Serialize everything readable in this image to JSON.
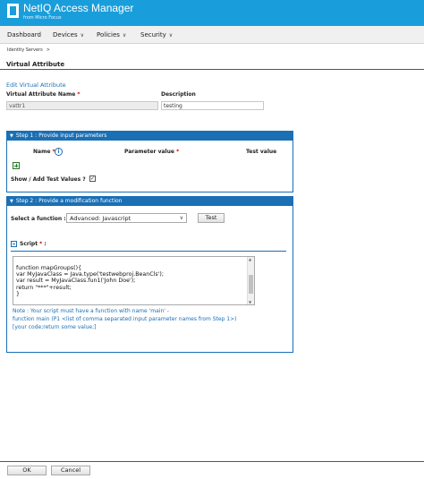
{
  "app": {
    "title": "NetIQ Access Manager",
    "subtitle": "from Micro Focus"
  },
  "nav": [
    {
      "label": "Dashboard",
      "has_menu": false
    },
    {
      "label": "Devices",
      "has_menu": true
    },
    {
      "label": "Policies",
      "has_menu": true
    },
    {
      "label": "Security",
      "has_menu": true
    }
  ],
  "breadcrumb": {
    "item": "Identity Servers",
    "separator": ">"
  },
  "page_title": "Virtual Attribute",
  "section_title": "Edit Virtual Attribute",
  "form": {
    "name_label": "Virtual Attribute Name",
    "name_value": "vattr1",
    "description_label": "Description",
    "description_value": "testing"
  },
  "step1": {
    "header": "Step 1 : Provide input parameters",
    "col_name": "Name",
    "col_param": "Parameter value",
    "col_test": "Test value",
    "show_test_label": "Show / Add Test Values ?",
    "show_test_checked": true
  },
  "step2": {
    "header": "Step 2 : Provide a modification function",
    "select_label": "Select a function :",
    "select_value": "Advanced: Javascript",
    "test_button": "Test",
    "script_label": "Script",
    "script_lines": [
      "function mapGroups(){",
      "var MyJavaClass = Java.type('testwebproj.BeanCls');",
      "var result = MyJavaClass.fun1('John Doe');",
      "return \"***\"+result;",
      "}"
    ],
    "note_lines": [
      "Note : Your script must have a function with name 'main' -",
      "function main (P1 <list of comma separated input parameter names from Step 1>)",
      "[your code;return some value;]"
    ]
  },
  "footer": {
    "ok_label": "OK",
    "cancel_label": "Cancel"
  },
  "colors": {
    "header": "#1a9edb",
    "accent": "#1a6fb5",
    "required": "#dd0000"
  }
}
